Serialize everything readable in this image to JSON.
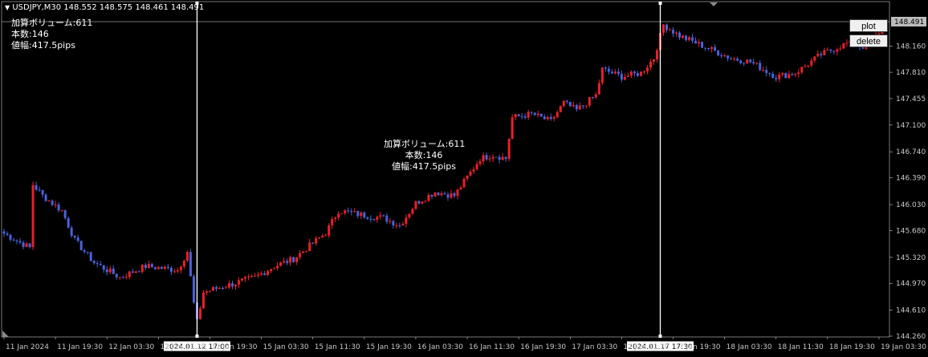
{
  "header": {
    "symbol_line": "USDJPY,M30  148.552 148.575 148.461 148.491"
  },
  "buttons": {
    "plot": "plot",
    "delete": "delete"
  },
  "info_left": {
    "volume": "加算ボリューム:611",
    "count": "本数:146",
    "range": "値幅:417.5pips"
  },
  "info_center": {
    "volume": "加算ボリューム:611",
    "count": "本数:146",
    "range": "値幅:417.5pips"
  },
  "colors": {
    "background": "#000000",
    "bull": "#e8202a",
    "bear": "#4a62d8",
    "grid_line": "#ffffff",
    "axis": "#c8c8c8"
  },
  "chart_data": {
    "type": "candlestick",
    "ylim": [
      144.26,
      148.53
    ],
    "y_ticks": [
      148.16,
      147.81,
      147.455,
      147.1,
      146.74,
      146.39,
      146.03,
      145.68,
      145.32,
      144.97,
      144.61,
      144.26
    ],
    "y_tick_labels": [
      "148.160",
      "147.810",
      "147.455",
      "147.100",
      "146.740",
      "146.390",
      "146.030",
      "145.680",
      "145.320",
      "144.970",
      "144.610",
      "144.260"
    ],
    "current_price": 148.491,
    "current_price_label": "148.491",
    "x_labels": [
      "11 Jan 2024",
      "11 Jan 19:30",
      "12 Jan 03:30",
      "12 Jan 11:30",
      "12 Jan 19:30",
      "15 Jan 03:30",
      "15 Jan 11:30",
      "15 Jan 19:30",
      "16 Jan 03:30",
      "16 Jan 11:30",
      "16 Jan 19:30",
      "17 Jan 03:30",
      "17 Jan 11:30",
      "17 Jan 19:30",
      "18 Jan 03:30",
      "18 Jan 11:30",
      "18 Jan 19:30",
      "19 Jan 03:30"
    ],
    "x_label_index": [
      0,
      16,
      32,
      48,
      64,
      80,
      96,
      112,
      128,
      144,
      160,
      176,
      192,
      208,
      224,
      240,
      256,
      272
    ],
    "n_bars": 275,
    "markers": [
      {
        "index": 60,
        "label": "2024.01.12 17:00"
      },
      {
        "index": 204,
        "label": "2024.01.17 17:30"
      }
    ],
    "anchors": [
      [
        0,
        145.64
      ],
      [
        8,
        145.45
      ],
      [
        9,
        146.3
      ],
      [
        12,
        146.15
      ],
      [
        18,
        145.95
      ],
      [
        22,
        145.55
      ],
      [
        28,
        145.25
      ],
      [
        36,
        145.05
      ],
      [
        44,
        145.2
      ],
      [
        54,
        145.15
      ],
      [
        57,
        145.4
      ],
      [
        59,
        144.7
      ],
      [
        60,
        144.45
      ],
      [
        62,
        144.85
      ],
      [
        70,
        144.95
      ],
      [
        78,
        145.05
      ],
      [
        84,
        145.2
      ],
      [
        90,
        145.3
      ],
      [
        100,
        145.65
      ],
      [
        104,
        145.95
      ],
      [
        110,
        145.9
      ],
      [
        118,
        145.85
      ],
      [
        123,
        145.75
      ],
      [
        128,
        146.05
      ],
      [
        134,
        146.2
      ],
      [
        140,
        146.15
      ],
      [
        148,
        146.65
      ],
      [
        152,
        146.7
      ],
      [
        156,
        146.65
      ],
      [
        158,
        147.2
      ],
      [
        164,
        147.25
      ],
      [
        170,
        147.15
      ],
      [
        174,
        147.4
      ],
      [
        178,
        147.3
      ],
      [
        184,
        147.5
      ],
      [
        186,
        147.85
      ],
      [
        192,
        147.75
      ],
      [
        198,
        147.8
      ],
      [
        202,
        148.0
      ],
      [
        205,
        148.45
      ],
      [
        210,
        148.3
      ],
      [
        218,
        148.15
      ],
      [
        226,
        148.0
      ],
      [
        232,
        147.95
      ],
      [
        240,
        147.75
      ],
      [
        246,
        147.8
      ],
      [
        254,
        148.05
      ],
      [
        262,
        148.2
      ],
      [
        268,
        148.15
      ],
      [
        274,
        148.45
      ]
    ]
  }
}
